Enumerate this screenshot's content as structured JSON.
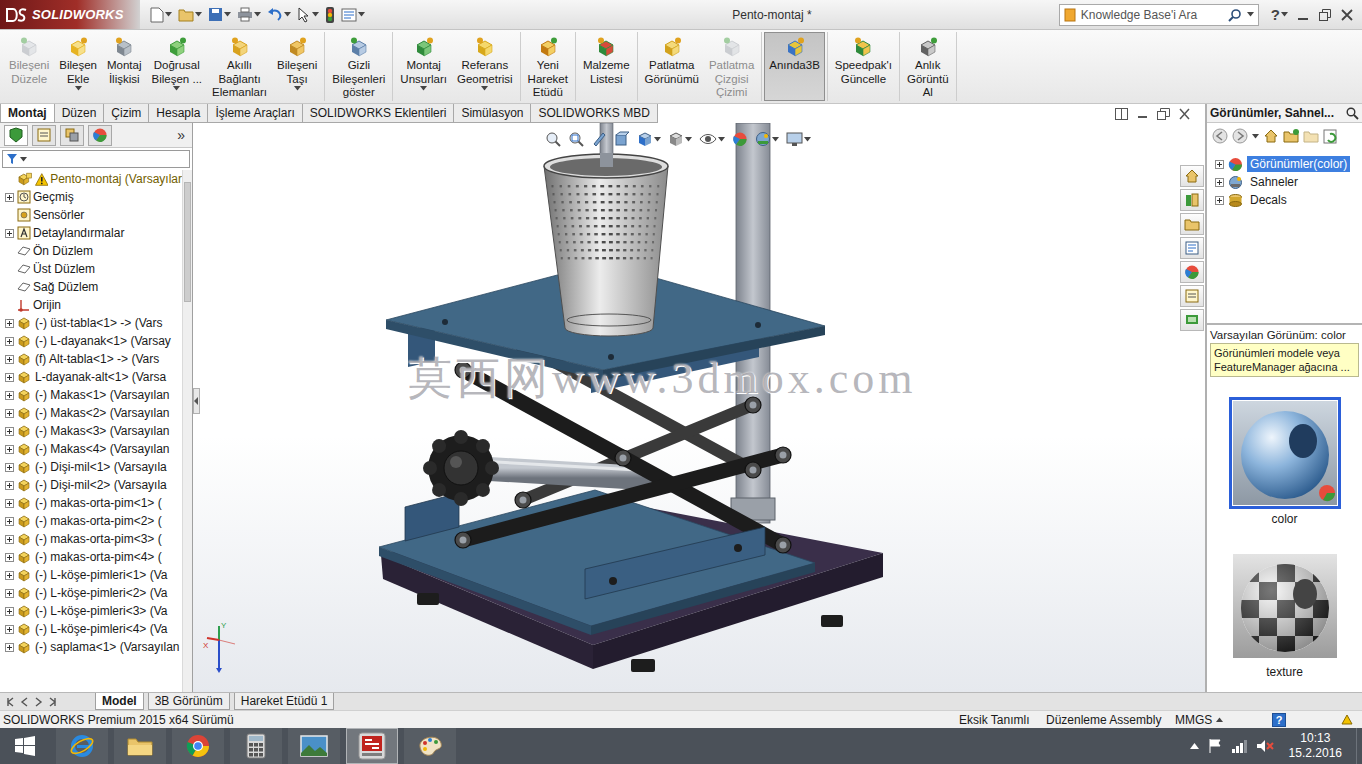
{
  "app": {
    "logo": "SOLIDWORKS",
    "title": "Pento-montaj *",
    "search": {
      "placeholder": "Knowledge Base'i Ara"
    },
    "help": "?"
  },
  "ribbon": [
    {
      "buttons": [
        {
          "lines": [
            "Bileşeni",
            "Düzele"
          ],
          "disabled": true,
          "selected": false,
          "dropdown": false
        },
        {
          "lines": [
            "Bileşen",
            "Ekle"
          ],
          "disabled": false,
          "selected": false,
          "dropdown": true
        },
        {
          "lines": [
            "Montaj",
            "İlişkisi"
          ],
          "disabled": false,
          "selected": false,
          "dropdown": false
        },
        {
          "lines": [
            "Doğrusal",
            "Bileşen ..."
          ],
          "disabled": false,
          "selected": false,
          "dropdown": true
        },
        {
          "lines": [
            "Akıllı",
            "Bağlantı",
            "Elemanları"
          ],
          "disabled": false,
          "selected": false,
          "dropdown": false
        },
        {
          "lines": [
            "Bileşeni",
            "Taşı"
          ],
          "disabled": false,
          "selected": false,
          "dropdown": true
        }
      ]
    },
    {
      "buttons": [
        {
          "lines": [
            "Gizli",
            "Bileşenleri",
            "göster"
          ],
          "disabled": false,
          "selected": false,
          "dropdown": false
        }
      ]
    },
    {
      "buttons": [
        {
          "lines": [
            "Montaj",
            "Unsurları"
          ],
          "disabled": false,
          "selected": false,
          "dropdown": true
        },
        {
          "lines": [
            "Referans",
            "Geometrisi"
          ],
          "disabled": false,
          "selected": false,
          "dropdown": true
        }
      ]
    },
    {
      "buttons": [
        {
          "lines": [
            "Yeni",
            "Hareket",
            "Etüdü"
          ],
          "disabled": false,
          "selected": false,
          "dropdown": false
        }
      ]
    },
    {
      "buttons": [
        {
          "lines": [
            "Malzeme",
            "Listesi"
          ],
          "disabled": false,
          "selected": false,
          "dropdown": false
        }
      ]
    },
    {
      "buttons": [
        {
          "lines": [
            "Patlatma",
            "Görünümü"
          ],
          "disabled": false,
          "selected": false,
          "dropdown": false
        },
        {
          "lines": [
            "Patlatma",
            "Çizgisi",
            "Çizimi"
          ],
          "disabled": true,
          "selected": false,
          "dropdown": false
        }
      ]
    },
    {
      "buttons": [
        {
          "lines": [
            "Anında3B"
          ],
          "disabled": false,
          "selected": true,
          "dropdown": false
        }
      ]
    },
    {
      "buttons": [
        {
          "lines": [
            "Speedpak'ı",
            "Güncelle"
          ],
          "disabled": false,
          "selected": false,
          "dropdown": false
        }
      ]
    },
    {
      "buttons": [
        {
          "lines": [
            "Anlık",
            "Görüntü",
            "Al"
          ],
          "disabled": false,
          "selected": false,
          "dropdown": false
        }
      ]
    }
  ],
  "tabs": [
    {
      "label": "Montaj",
      "selected": true
    },
    {
      "label": "Düzen",
      "selected": false
    },
    {
      "label": "Çizim",
      "selected": false
    },
    {
      "label": "Hesapla",
      "selected": false
    },
    {
      "label": "İşleme Araçları",
      "selected": false
    },
    {
      "label": "SOLIDWORKS Eklentileri",
      "selected": false
    },
    {
      "label": "Simülasyon",
      "selected": false
    },
    {
      "label": "SOLIDWORKS MBD",
      "selected": false
    }
  ],
  "panel": {
    "more": "»"
  },
  "tree": {
    "items": [
      {
        "label": "Pento-montaj (Varsayılar",
        "kind": "root",
        "expandable": false,
        "warning": true
      },
      {
        "label": "Geçmiş",
        "kind": "history",
        "expandable": true,
        "warning": false
      },
      {
        "label": "Sensörler",
        "kind": "sensor",
        "expandable": false,
        "warning": false
      },
      {
        "label": "Detaylandırmalar",
        "kind": "annotation",
        "expandable": true,
        "warning": false
      },
      {
        "label": "Ön Düzlem",
        "kind": "plane",
        "expandable": false,
        "warning": false
      },
      {
        "label": "Üst Düzlem",
        "kind": "plane",
        "expandable": false,
        "warning": false
      },
      {
        "label": "Sağ Düzlem",
        "kind": "plane",
        "expandable": false,
        "warning": false
      },
      {
        "label": "Orijin",
        "kind": "origin",
        "expandable": false,
        "warning": false
      },
      {
        "label": "(-) üst-tabla<1> -> (Vars",
        "kind": "component",
        "expandable": true,
        "warning": false
      },
      {
        "label": "(-) L-dayanak<1> (Varsay",
        "kind": "component",
        "expandable": true,
        "warning": false
      },
      {
        "label": "(f) Alt-tabla<1> -> (Vars",
        "kind": "component",
        "expandable": true,
        "warning": false
      },
      {
        "label": "L-dayanak-alt<1> (Varsa",
        "kind": "component",
        "expandable": true,
        "warning": false
      },
      {
        "label": "(-) Makas<1> (Varsayılan",
        "kind": "component",
        "expandable": true,
        "warning": false
      },
      {
        "label": "(-) Makas<2> (Varsayılan",
        "kind": "component",
        "expandable": true,
        "warning": false
      },
      {
        "label": "(-) Makas<3> (Varsayılan",
        "kind": "component",
        "expandable": true,
        "warning": false
      },
      {
        "label": "(-) Makas<4> (Varsayılan",
        "kind": "component",
        "expandable": true,
        "warning": false
      },
      {
        "label": "(-) Dişi-mil<1> (Varsayıla",
        "kind": "component",
        "expandable": true,
        "warning": false
      },
      {
        "label": "(-) Dişi-mil<2> (Varsayıla",
        "kind": "component",
        "expandable": true,
        "warning": false
      },
      {
        "label": "(-) makas-orta-pim<1> (",
        "kind": "component",
        "expandable": true,
        "warning": false
      },
      {
        "label": "(-) makas-orta-pim<2> (",
        "kind": "component",
        "expandable": true,
        "warning": false
      },
      {
        "label": "(-) makas-orta-pim<3> (",
        "kind": "component",
        "expandable": true,
        "warning": false
      },
      {
        "label": "(-) makas-orta-pim<4> (",
        "kind": "component",
        "expandable": true,
        "warning": false
      },
      {
        "label": "(-) L-köşe-pimleri<1> (Va",
        "kind": "component",
        "expandable": true,
        "warning": false
      },
      {
        "label": "(-) L-köşe-pimleri<2> (Va",
        "kind": "component",
        "expandable": true,
        "warning": false
      },
      {
        "label": "(-) L-köşe-pimleri<3> (Va",
        "kind": "component",
        "expandable": true,
        "warning": false
      },
      {
        "label": "(-) L-köşe-pimleri<4> (Va",
        "kind": "component",
        "expandable": true,
        "warning": false
      },
      {
        "label": "(-) saplama<1> (Varsayılan",
        "kind": "component",
        "expandable": true,
        "warning": false
      }
    ]
  },
  "viewport": {
    "watermark": "莫西网www.3dmox.com",
    "triad": [
      "Y",
      "X"
    ]
  },
  "taskPane": {
    "title": "Görünümler, Sahnel...",
    "items": [
      {
        "label": "Görünümler(color)",
        "selected": true,
        "kind": "appearance"
      },
      {
        "label": "Sahneler",
        "selected": false,
        "kind": "scene"
      },
      {
        "label": "Decals",
        "selected": false,
        "kind": "decal"
      }
    ],
    "current": "Varsayılan Görünüm: color",
    "tip": [
      "Görünümleri modele veya",
      "FeatureManager ağacına ..."
    ],
    "swatches": [
      {
        "label": "color",
        "selected": true,
        "kind": "color"
      },
      {
        "label": "texture",
        "selected": false,
        "kind": "texture"
      }
    ]
  },
  "bottomTabs": [
    {
      "label": "Model",
      "selected": true
    },
    {
      "label": "3B Görünüm",
      "selected": false
    },
    {
      "label": "Hareket Etüdü 1",
      "selected": false
    }
  ],
  "status": {
    "version": "SOLIDWORKS Premium 2015 x64 Sürümü",
    "state": "Eksik Tanımlı",
    "mode": "Düzenleme Assembly",
    "units": "MMGS",
    "help": "?"
  },
  "taskbar": {
    "apps": [
      {
        "kind": "ie",
        "selected": false
      },
      {
        "kind": "explorer",
        "selected": false
      },
      {
        "kind": "chrome",
        "selected": false
      },
      {
        "kind": "calculator",
        "selected": false
      },
      {
        "kind": "photos",
        "selected": false
      },
      {
        "kind": "solidworks",
        "selected": true
      },
      {
        "kind": "paint",
        "selected": false
      }
    ],
    "time": "10:13",
    "date": "15.2.2016"
  }
}
